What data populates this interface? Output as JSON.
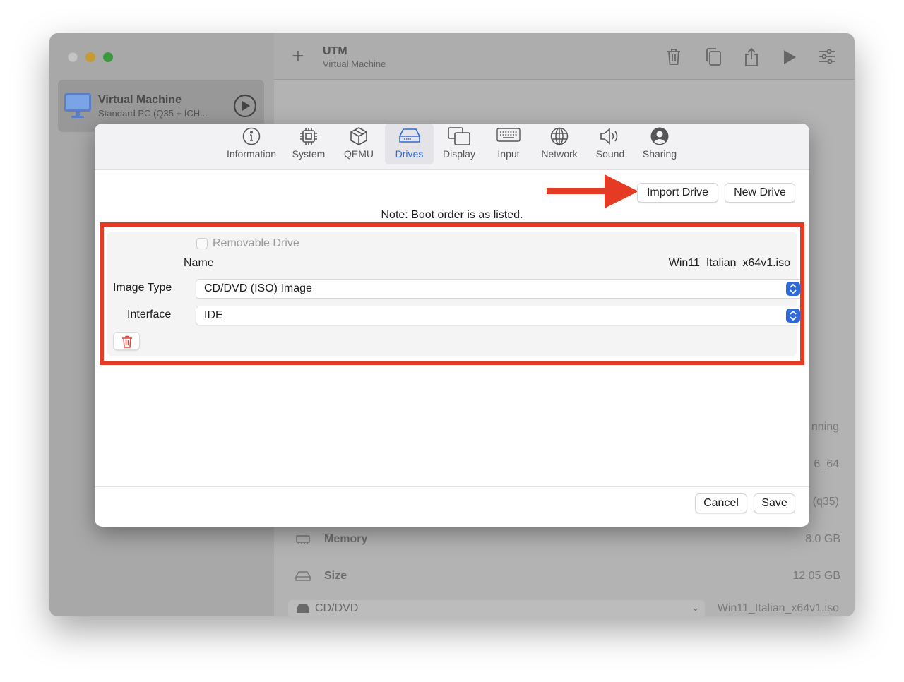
{
  "window": {
    "title": "UTM",
    "subtitle": "Virtual Machine",
    "traffic_lights": {
      "close": "#c4c4c4",
      "minimize": "#c79a33",
      "maximize": "#3b9b3c"
    }
  },
  "sidebar": {
    "vm": {
      "name": "Virtual Machine",
      "description": "Standard PC (Q35 + ICH..."
    }
  },
  "toolbar": {
    "icons": [
      "trash-icon",
      "clone-icon",
      "share-icon",
      "play-icon",
      "settings-sliders-icon"
    ]
  },
  "detail": {
    "partial_status": "nning",
    "partial_arch": "6_64",
    "partial_machine": "(q35)",
    "memory": {
      "label": "Memory",
      "value": "8.0 GB"
    },
    "size": {
      "label": "Size",
      "value": "12,05 GB"
    },
    "drive": {
      "label": "CD/DVD",
      "value": "Win11_Italian_x64v1.iso"
    }
  },
  "dialog": {
    "tabs": [
      {
        "label": "Information",
        "icon": "info-icon"
      },
      {
        "label": "System",
        "icon": "cpu-icon"
      },
      {
        "label": "QEMU",
        "icon": "box-icon"
      },
      {
        "label": "Drives",
        "icon": "drive-icon",
        "active": true
      },
      {
        "label": "Display",
        "icon": "display-icon"
      },
      {
        "label": "Input",
        "icon": "keyboard-icon"
      },
      {
        "label": "Network",
        "icon": "globe-icon"
      },
      {
        "label": "Sound",
        "icon": "speaker-icon"
      },
      {
        "label": "Sharing",
        "icon": "person-icon"
      }
    ],
    "import_drive": "Import Drive",
    "new_drive": "New Drive",
    "note": "Note: Boot order is as listed.",
    "drive": {
      "removable_label": "Removable Drive",
      "removable_checked": false,
      "name_label": "Name",
      "name_value": "Win11_Italian_x64v1.iso",
      "image_type_label": "Image Type",
      "image_type_value": "CD/DVD (ISO) Image",
      "interface_label": "Interface",
      "interface_value": "IDE"
    },
    "cancel": "Cancel",
    "save": "Save"
  },
  "colors": {
    "accent": "#2f6bd8",
    "annotation": "#e53a24",
    "delete": "#e0443a"
  }
}
